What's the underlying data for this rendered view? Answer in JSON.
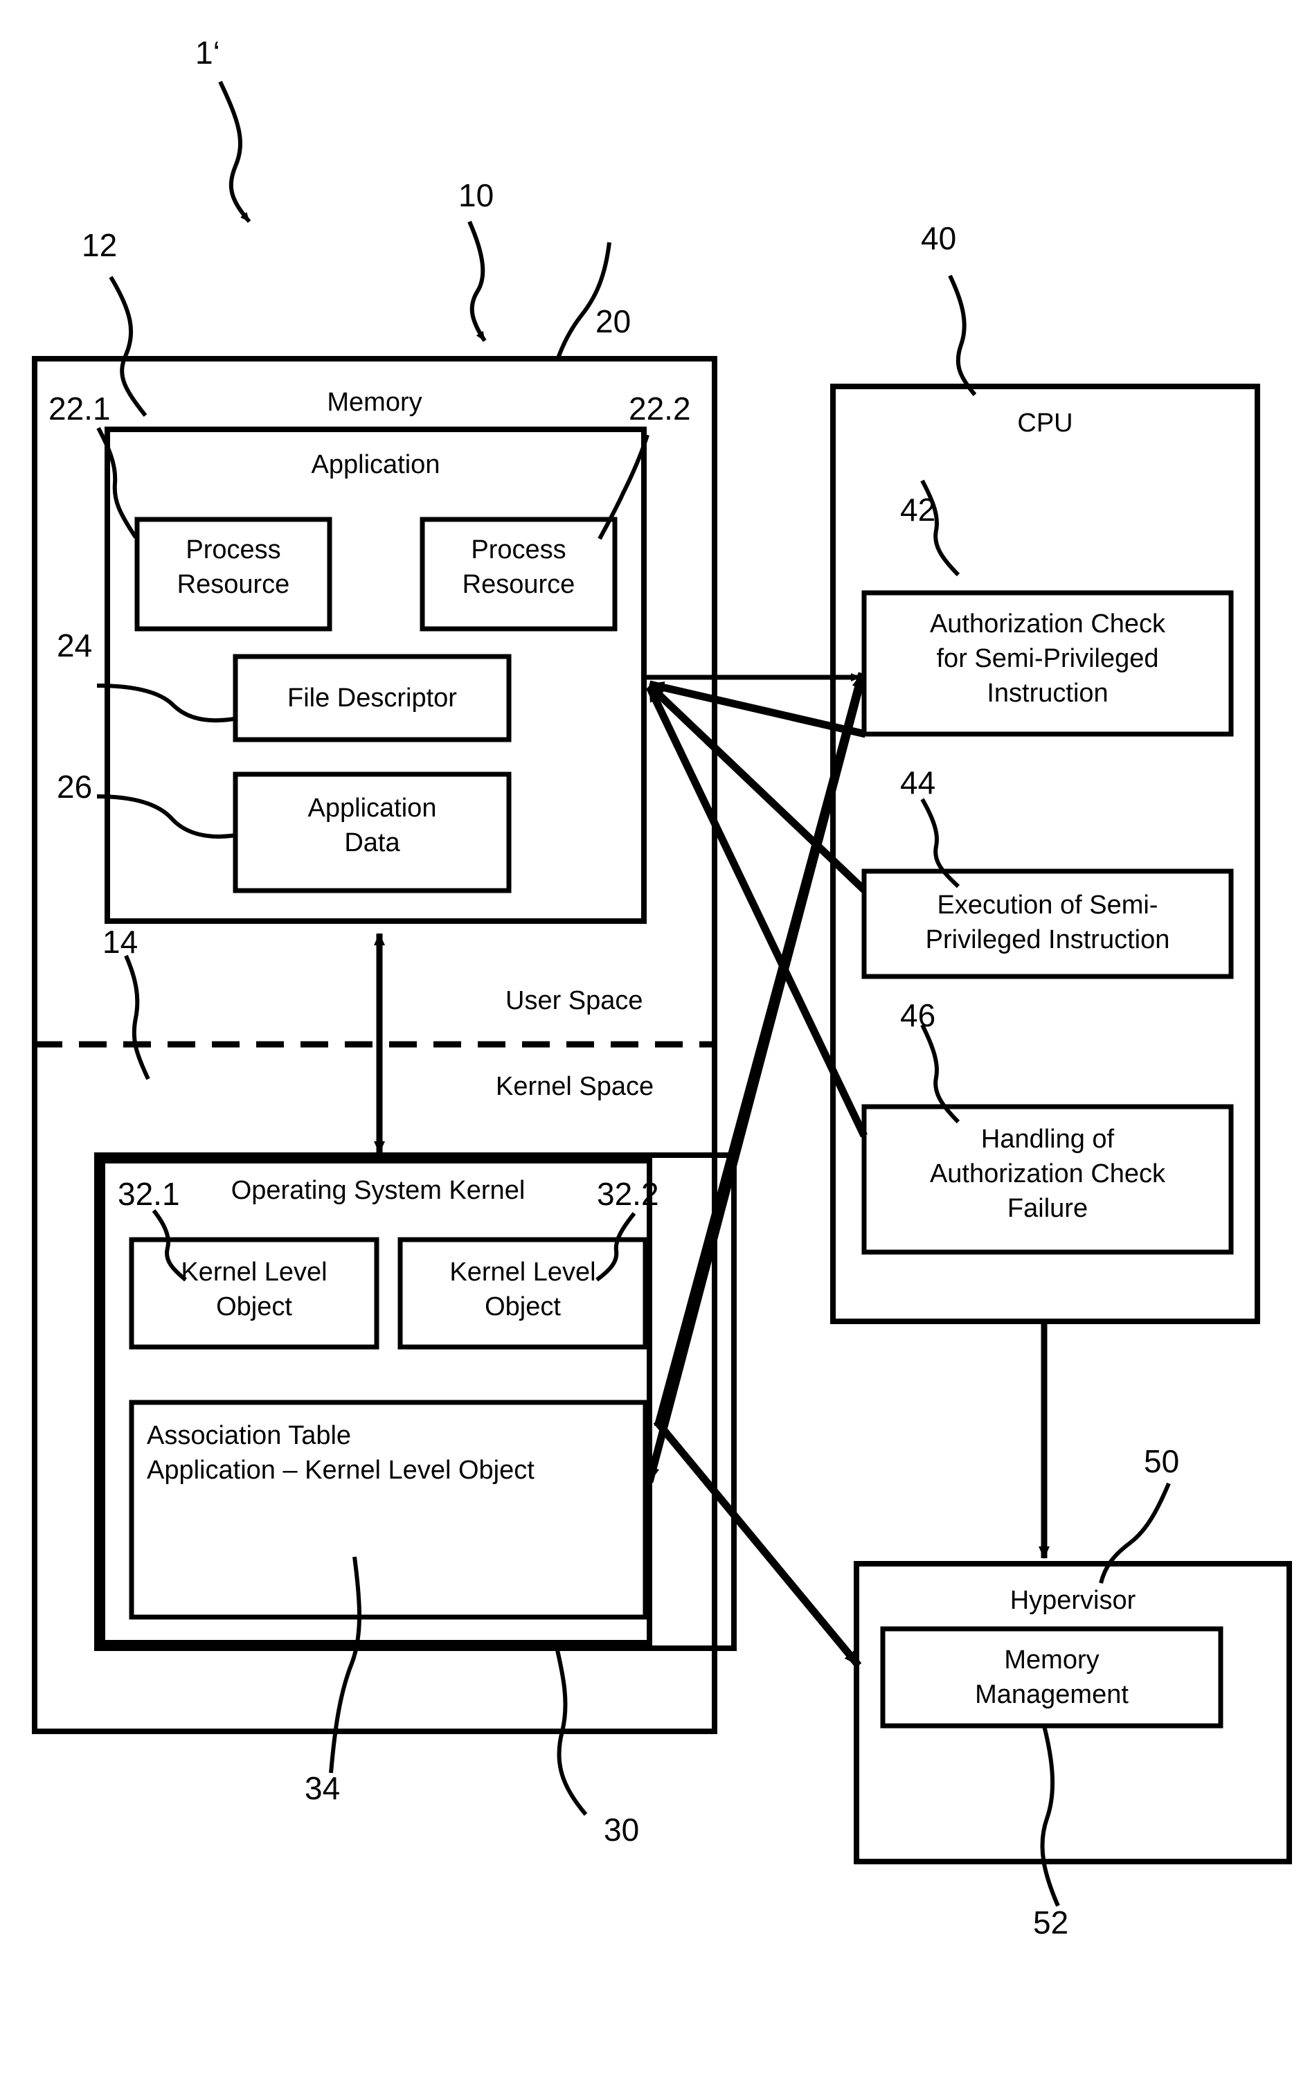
{
  "figure": {
    "main_reference": "1‘",
    "references": {
      "system": "1‘",
      "memory": "10",
      "memory_label_left": "12",
      "application": "20",
      "process_resource_1": "22.1",
      "process_resource_2": "22.2",
      "file_descriptor": "24",
      "application_data": "26",
      "space_divider": "14",
      "os_kernel": "30",
      "kernel_level_object_1": "32.1",
      "kernel_level_object_2": "32.2",
      "association_table": "34",
      "cpu": "40",
      "authorization_check": "42",
      "execution": "44",
      "handling_failure": "46",
      "hypervisor": "50",
      "memory_management": "52"
    }
  },
  "memory": {
    "title": "Memory",
    "application": {
      "title": "Application",
      "process_resource_1": "Process\nResource",
      "process_resource_2": "Process\nResource",
      "file_descriptor": "File Descriptor",
      "application_data": "Application\nData"
    },
    "user_space_label": "User Space",
    "kernel_space_label": "Kernel Space",
    "os_kernel": {
      "title": "Operating System Kernel",
      "kernel_level_object_1": "Kernel Level\nObject",
      "kernel_level_object_2": "Kernel Level\nObject",
      "association_table": "Association Table\nApplication – Kernel Level Object"
    }
  },
  "cpu": {
    "title": "CPU",
    "blocks": [
      "Authorization Check\nfor Semi-Privileged\nInstruction",
      "Execution of Semi-\nPrivileged Instruction",
      "Handling of\nAuthorization Check\nFailure"
    ]
  },
  "hypervisor": {
    "title": "Hypervisor",
    "memory_management": "Memory\nManagement"
  },
  "colors": {
    "stroke": "#000000",
    "background": "#ffffff"
  }
}
